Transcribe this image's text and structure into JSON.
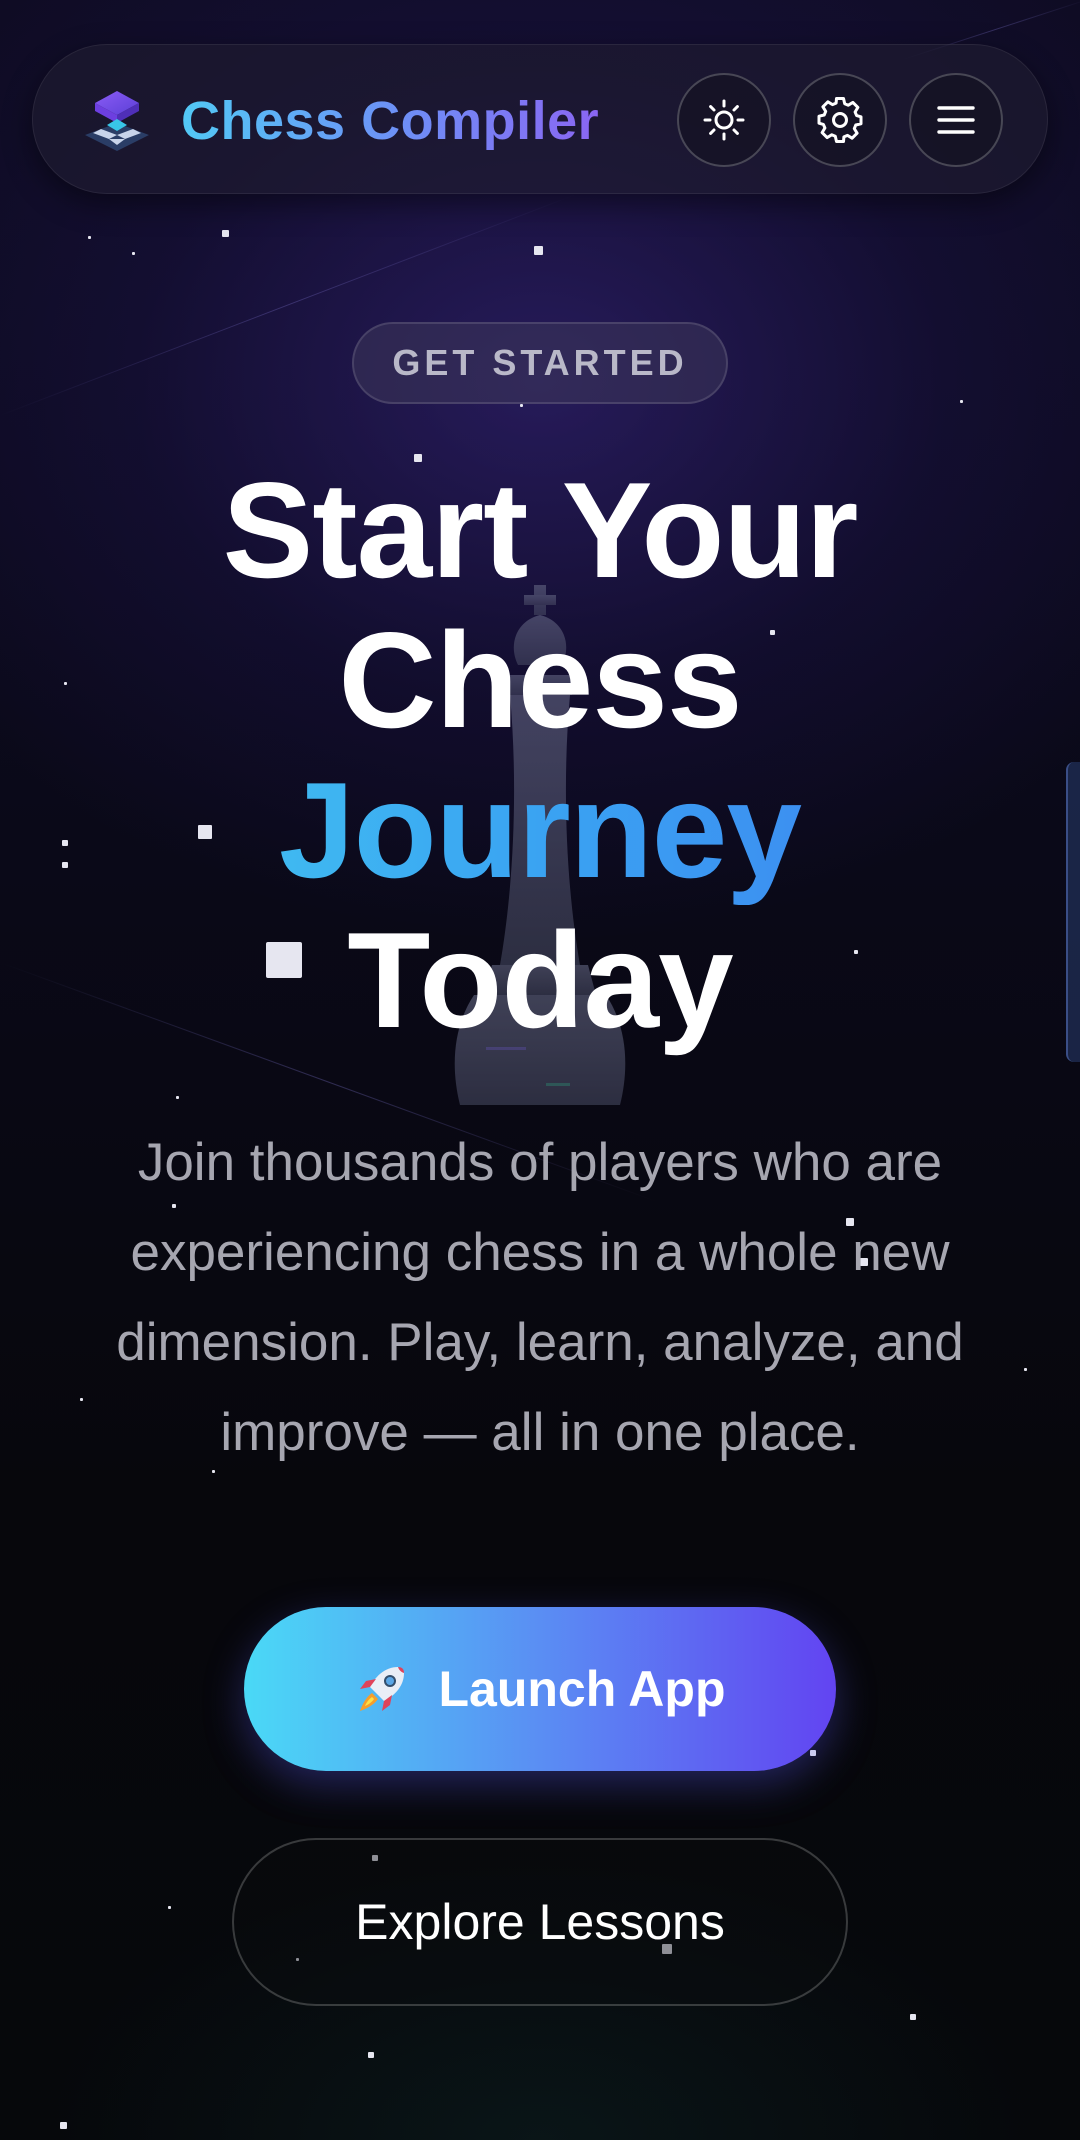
{
  "header": {
    "brand": "Chess Compiler",
    "theme_toggle_icon": "sun-icon",
    "settings_icon": "gear-icon",
    "menu_icon": "hamburger-menu-icon"
  },
  "hero": {
    "badge": "GET STARTED",
    "headline_line1": "Start Your",
    "headline_line2": "Chess",
    "headline_accent": "Journey",
    "headline_line4": "Today",
    "subtitle": "Join thousands of players who are experiencing chess in a whole new dimension. Play, learn, analyze, and improve — all in one place."
  },
  "actions": {
    "primary_icon": "rocket-icon",
    "primary_label": "Launch App",
    "secondary_label": "Explore Lessons"
  },
  "colors": {
    "background": "#07070c",
    "brand_gradient_start": "#52c9f5",
    "brand_gradient_end": "#8a66f2",
    "primary_button_start": "#4ad9f6",
    "primary_button_end": "#6244f2",
    "headline_accent": "#3aa3f2"
  }
}
